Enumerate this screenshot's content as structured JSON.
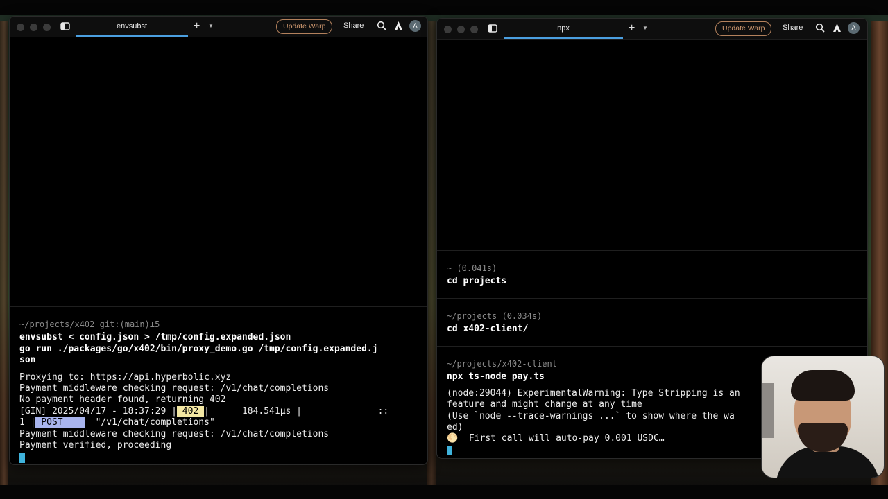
{
  "left_window": {
    "tab_label": "envsubst",
    "update_label": "Update Warp",
    "share_label": "Share",
    "avatar_letter": "A",
    "terminal": {
      "prompt": "~/projects/x402 git:(main)±5",
      "commands": [
        "envsubst < config.json > /tmp/config.expanded.json",
        "go run ./packages/go/x402/bin/proxy_demo.go /tmp/config.expanded.j",
        "son"
      ],
      "output": {
        "l1": "Proxying to: https://api.hyperbolic.xyz",
        "l2": "Payment middleware checking request: /v1/chat/completions",
        "l3": "No payment header found, returning 402",
        "gin_prefix": "[GIN] 2025/04/17 - 18:37:29 |",
        "status": " 402 ",
        "gin_mid": "|      184.541µs |              ::",
        "gin_line2_prefix": "1 |",
        "method": " POST    ",
        "gin_path": "  \"/v1/chat/completions\"",
        "l5": "Payment middleware checking request: /v1/chat/completions",
        "l6": "Payment verified, proceeding"
      }
    }
  },
  "right_window": {
    "tab_label": "npx",
    "update_label": "Update Warp",
    "share_label": "Share",
    "avatar_letter": "A",
    "blocks": [
      {
        "prompt": "~ (0.041s)",
        "command": "cd projects"
      },
      {
        "prompt": "~/projects (0.034s)",
        "command": "cd x402-client/"
      },
      {
        "prompt": "~/projects/x402-client",
        "command": "npx ts-node pay.ts"
      }
    ],
    "output": {
      "l1": "(node:29044) ExperimentalWarning: Type Stripping is an",
      "l2": "feature and might change at any time",
      "l3": "(Use `node --trace-warnings ...` to show where the wa",
      "l4": "ed)",
      "l5": "🌕  First call will auto-pay 0.001 USDC…"
    }
  },
  "colors": {
    "accent_tab": "#4b9fe0",
    "update_border": "#b3815c",
    "highlight_402": "#f2e6a2",
    "highlight_post": "#a8b4ee",
    "cursor": "#3fb3dc"
  }
}
